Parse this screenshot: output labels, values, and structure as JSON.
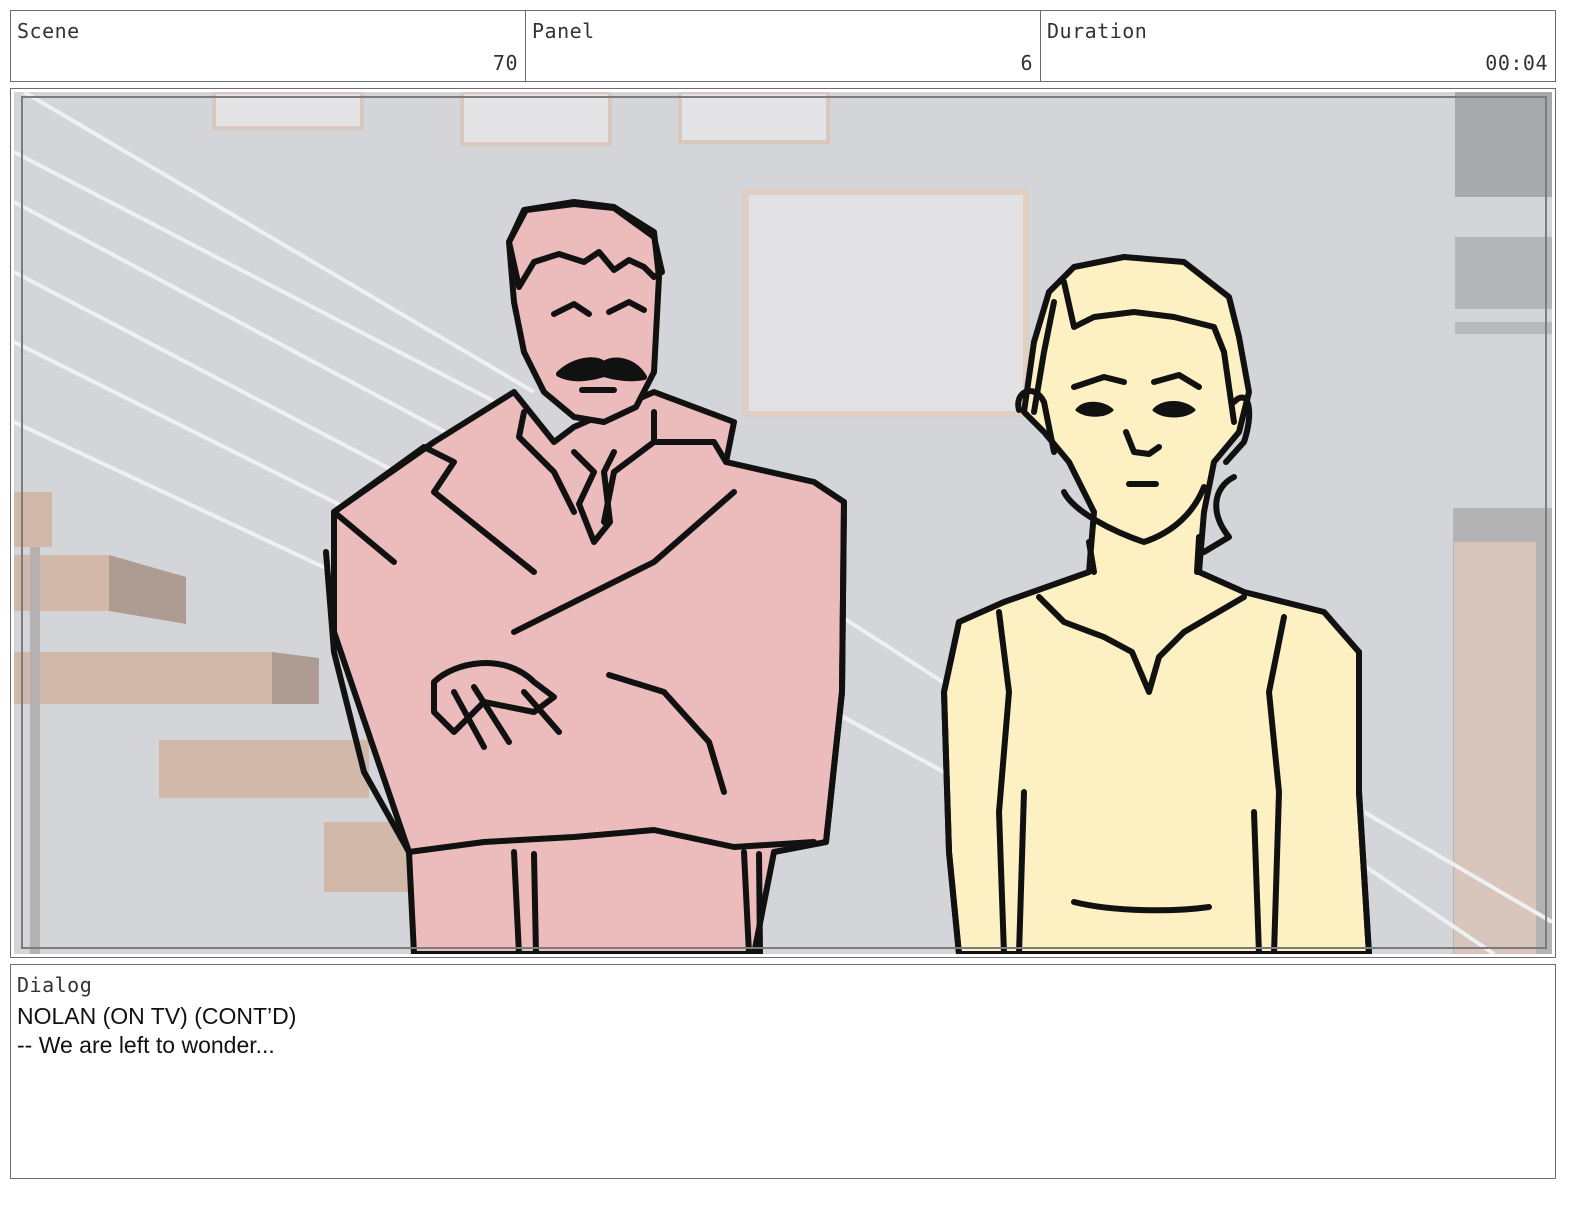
{
  "header": {
    "scene_label": "Scene",
    "scene_value": "70",
    "panel_label": "Panel",
    "panel_value": "6",
    "duration_label": "Duration",
    "duration_value": "00:04"
  },
  "dialog": {
    "label": "Dialog",
    "speaker": "NOLAN (ON TV) (CONT’D)",
    "line": "-- We are left to wonder..."
  },
  "colors": {
    "wall": "#d3d5d9",
    "stair": "#d2b8a8",
    "man_fill": "#ecbcbc",
    "woman_fill": "#fdf0c2",
    "ink": "#111111"
  }
}
